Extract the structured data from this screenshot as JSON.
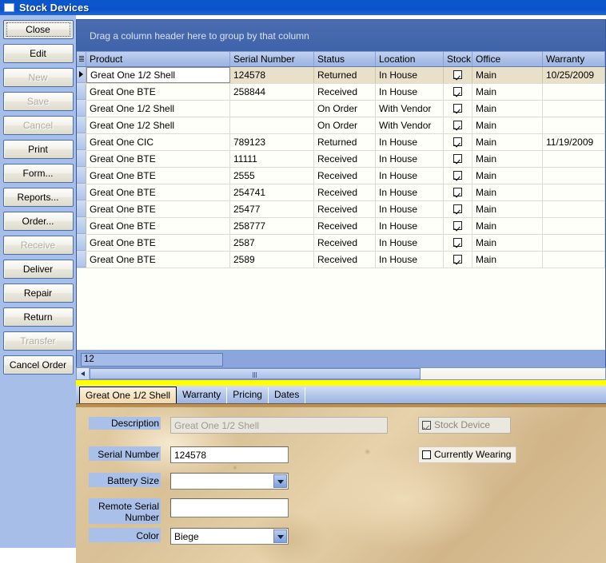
{
  "window": {
    "title": "Stock Devices",
    "icon": "window-icon"
  },
  "sidebar": {
    "buttons": [
      {
        "label": "Close",
        "disabled": false,
        "focused": true
      },
      {
        "label": "Edit",
        "disabled": false,
        "focused": false
      },
      {
        "label": "New",
        "disabled": true,
        "focused": false
      },
      {
        "label": "Save",
        "disabled": true,
        "focused": false
      },
      {
        "label": "Cancel",
        "disabled": true,
        "focused": false
      },
      {
        "label": "Print",
        "disabled": false,
        "focused": false
      },
      {
        "label": "Form...",
        "disabled": false,
        "focused": false
      },
      {
        "label": "Reports...",
        "disabled": false,
        "focused": false
      },
      {
        "label": "Order...",
        "disabled": false,
        "focused": false
      },
      {
        "label": "Receive",
        "disabled": true,
        "focused": false
      },
      {
        "label": "Deliver",
        "disabled": false,
        "focused": false
      },
      {
        "label": "Repair",
        "disabled": false,
        "focused": false
      },
      {
        "label": "Return",
        "disabled": false,
        "focused": false
      },
      {
        "label": "Transfer",
        "disabled": true,
        "focused": false
      },
      {
        "label": "Cancel Order",
        "disabled": false,
        "focused": false
      }
    ]
  },
  "grid": {
    "group_hint": "Drag a column header here to group by that column",
    "columns": [
      {
        "key": "product",
        "label": "Product"
      },
      {
        "key": "serial",
        "label": "Serial Number"
      },
      {
        "key": "status",
        "label": "Status"
      },
      {
        "key": "location",
        "label": "Location"
      },
      {
        "key": "stock",
        "label": "Stock"
      },
      {
        "key": "office",
        "label": "Office"
      },
      {
        "key": "warranty",
        "label": "Warranty"
      }
    ],
    "rows": [
      {
        "product": "Great One 1/2 Shell",
        "serial": "124578",
        "status": "Returned",
        "location": "In House",
        "stock": true,
        "office": "Main",
        "warranty": "10/25/2009",
        "selected": true
      },
      {
        "product": "Great One BTE",
        "serial": "258844",
        "status": "Received",
        "location": "In House",
        "stock": true,
        "office": "Main",
        "warranty": "",
        "selected": false
      },
      {
        "product": "Great One 1/2 Shell",
        "serial": "",
        "status": "On Order",
        "location": "With Vendor",
        "stock": true,
        "office": "Main",
        "warranty": "",
        "selected": false
      },
      {
        "product": "Great One 1/2 Shell",
        "serial": "",
        "status": "On Order",
        "location": "With Vendor",
        "stock": true,
        "office": "Main",
        "warranty": "",
        "selected": false
      },
      {
        "product": "Great One CIC",
        "serial": "789123",
        "status": "Returned",
        "location": "In House",
        "stock": true,
        "office": "Main",
        "warranty": "11/19/2009",
        "selected": false
      },
      {
        "product": "Great One BTE",
        "serial": "11111",
        "status": "Received",
        "location": "In House",
        "stock": true,
        "office": "Main",
        "warranty": "",
        "selected": false
      },
      {
        "product": "Great One BTE",
        "serial": "2555",
        "status": "Received",
        "location": "In House",
        "stock": true,
        "office": "Main",
        "warranty": "",
        "selected": false
      },
      {
        "product": "Great One BTE",
        "serial": "254741",
        "status": "Received",
        "location": "In House",
        "stock": true,
        "office": "Main",
        "warranty": "",
        "selected": false
      },
      {
        "product": "Great One BTE",
        "serial": "25477",
        "status": "Received",
        "location": "In House",
        "stock": true,
        "office": "Main",
        "warranty": "",
        "selected": false
      },
      {
        "product": "Great One BTE",
        "serial": "258777",
        "status": "Received",
        "location": "In House",
        "stock": true,
        "office": "Main",
        "warranty": "",
        "selected": false
      },
      {
        "product": "Great One BTE",
        "serial": "2587",
        "status": "Received",
        "location": "In House",
        "stock": true,
        "office": "Main",
        "warranty": "",
        "selected": false
      },
      {
        "product": "Great One BTE",
        "serial": "2589",
        "status": "Received",
        "location": "In House",
        "stock": true,
        "office": "Main",
        "warranty": "",
        "selected": false
      }
    ],
    "record_count": "12"
  },
  "tabs": [
    {
      "label": "Great One 1/2 Shell",
      "active": true
    },
    {
      "label": "Warranty",
      "active": false
    },
    {
      "label": "Pricing",
      "active": false
    },
    {
      "label": "Dates",
      "active": false
    }
  ],
  "detail": {
    "description_label": "Description",
    "description_value": "Great One 1/2 Shell",
    "serial_label": "Serial Number",
    "serial_value": "124578",
    "battery_label": "Battery Size",
    "battery_value": "",
    "remote_label": "Remote Serial Number",
    "remote_value": "",
    "color_label": "Color",
    "color_value": "Biege",
    "stock_device_label": "Stock Device",
    "stock_device_checked": true,
    "currently_wearing_label": "Currently Wearing",
    "currently_wearing_checked": false
  },
  "colors": {
    "titlebar": "#0b55d0",
    "panel": "#a7bfe8",
    "grid_header": "#aabfe6",
    "selected_row": "#e8e0c8",
    "accent_yellow": "#ffff00",
    "label_highlight": "#a9c0e8"
  }
}
